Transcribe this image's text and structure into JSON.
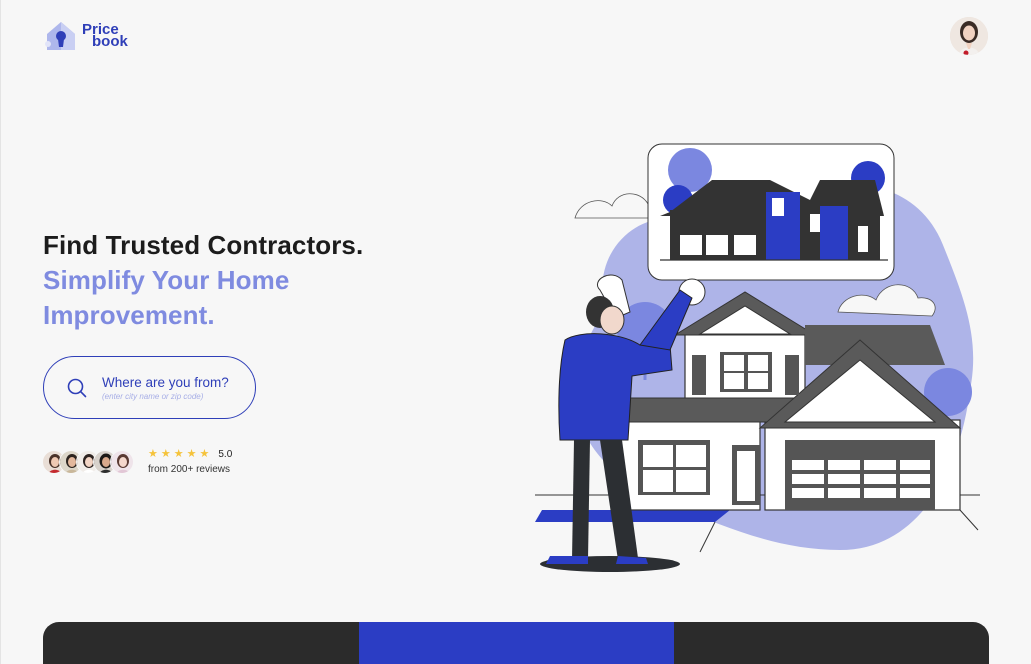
{
  "brand": {
    "name_line1": "Price",
    "name_line2": "book",
    "color": "#2f3fb8"
  },
  "hero": {
    "headline_line1": "Find Trusted Contractors.",
    "headline_line2": "Simplify Your Home",
    "headline_line3": "Improvement.",
    "accent_color": "#7f8be0"
  },
  "search": {
    "label": "Where are you from?",
    "hint": "(enter city name or zip code)",
    "icon": "search-icon"
  },
  "reviews": {
    "stars": 5,
    "score": "5.0",
    "count_text": "from 200+ reviews"
  },
  "icons": {
    "logo": "house-keyhole-logo",
    "user": "user-avatar"
  }
}
